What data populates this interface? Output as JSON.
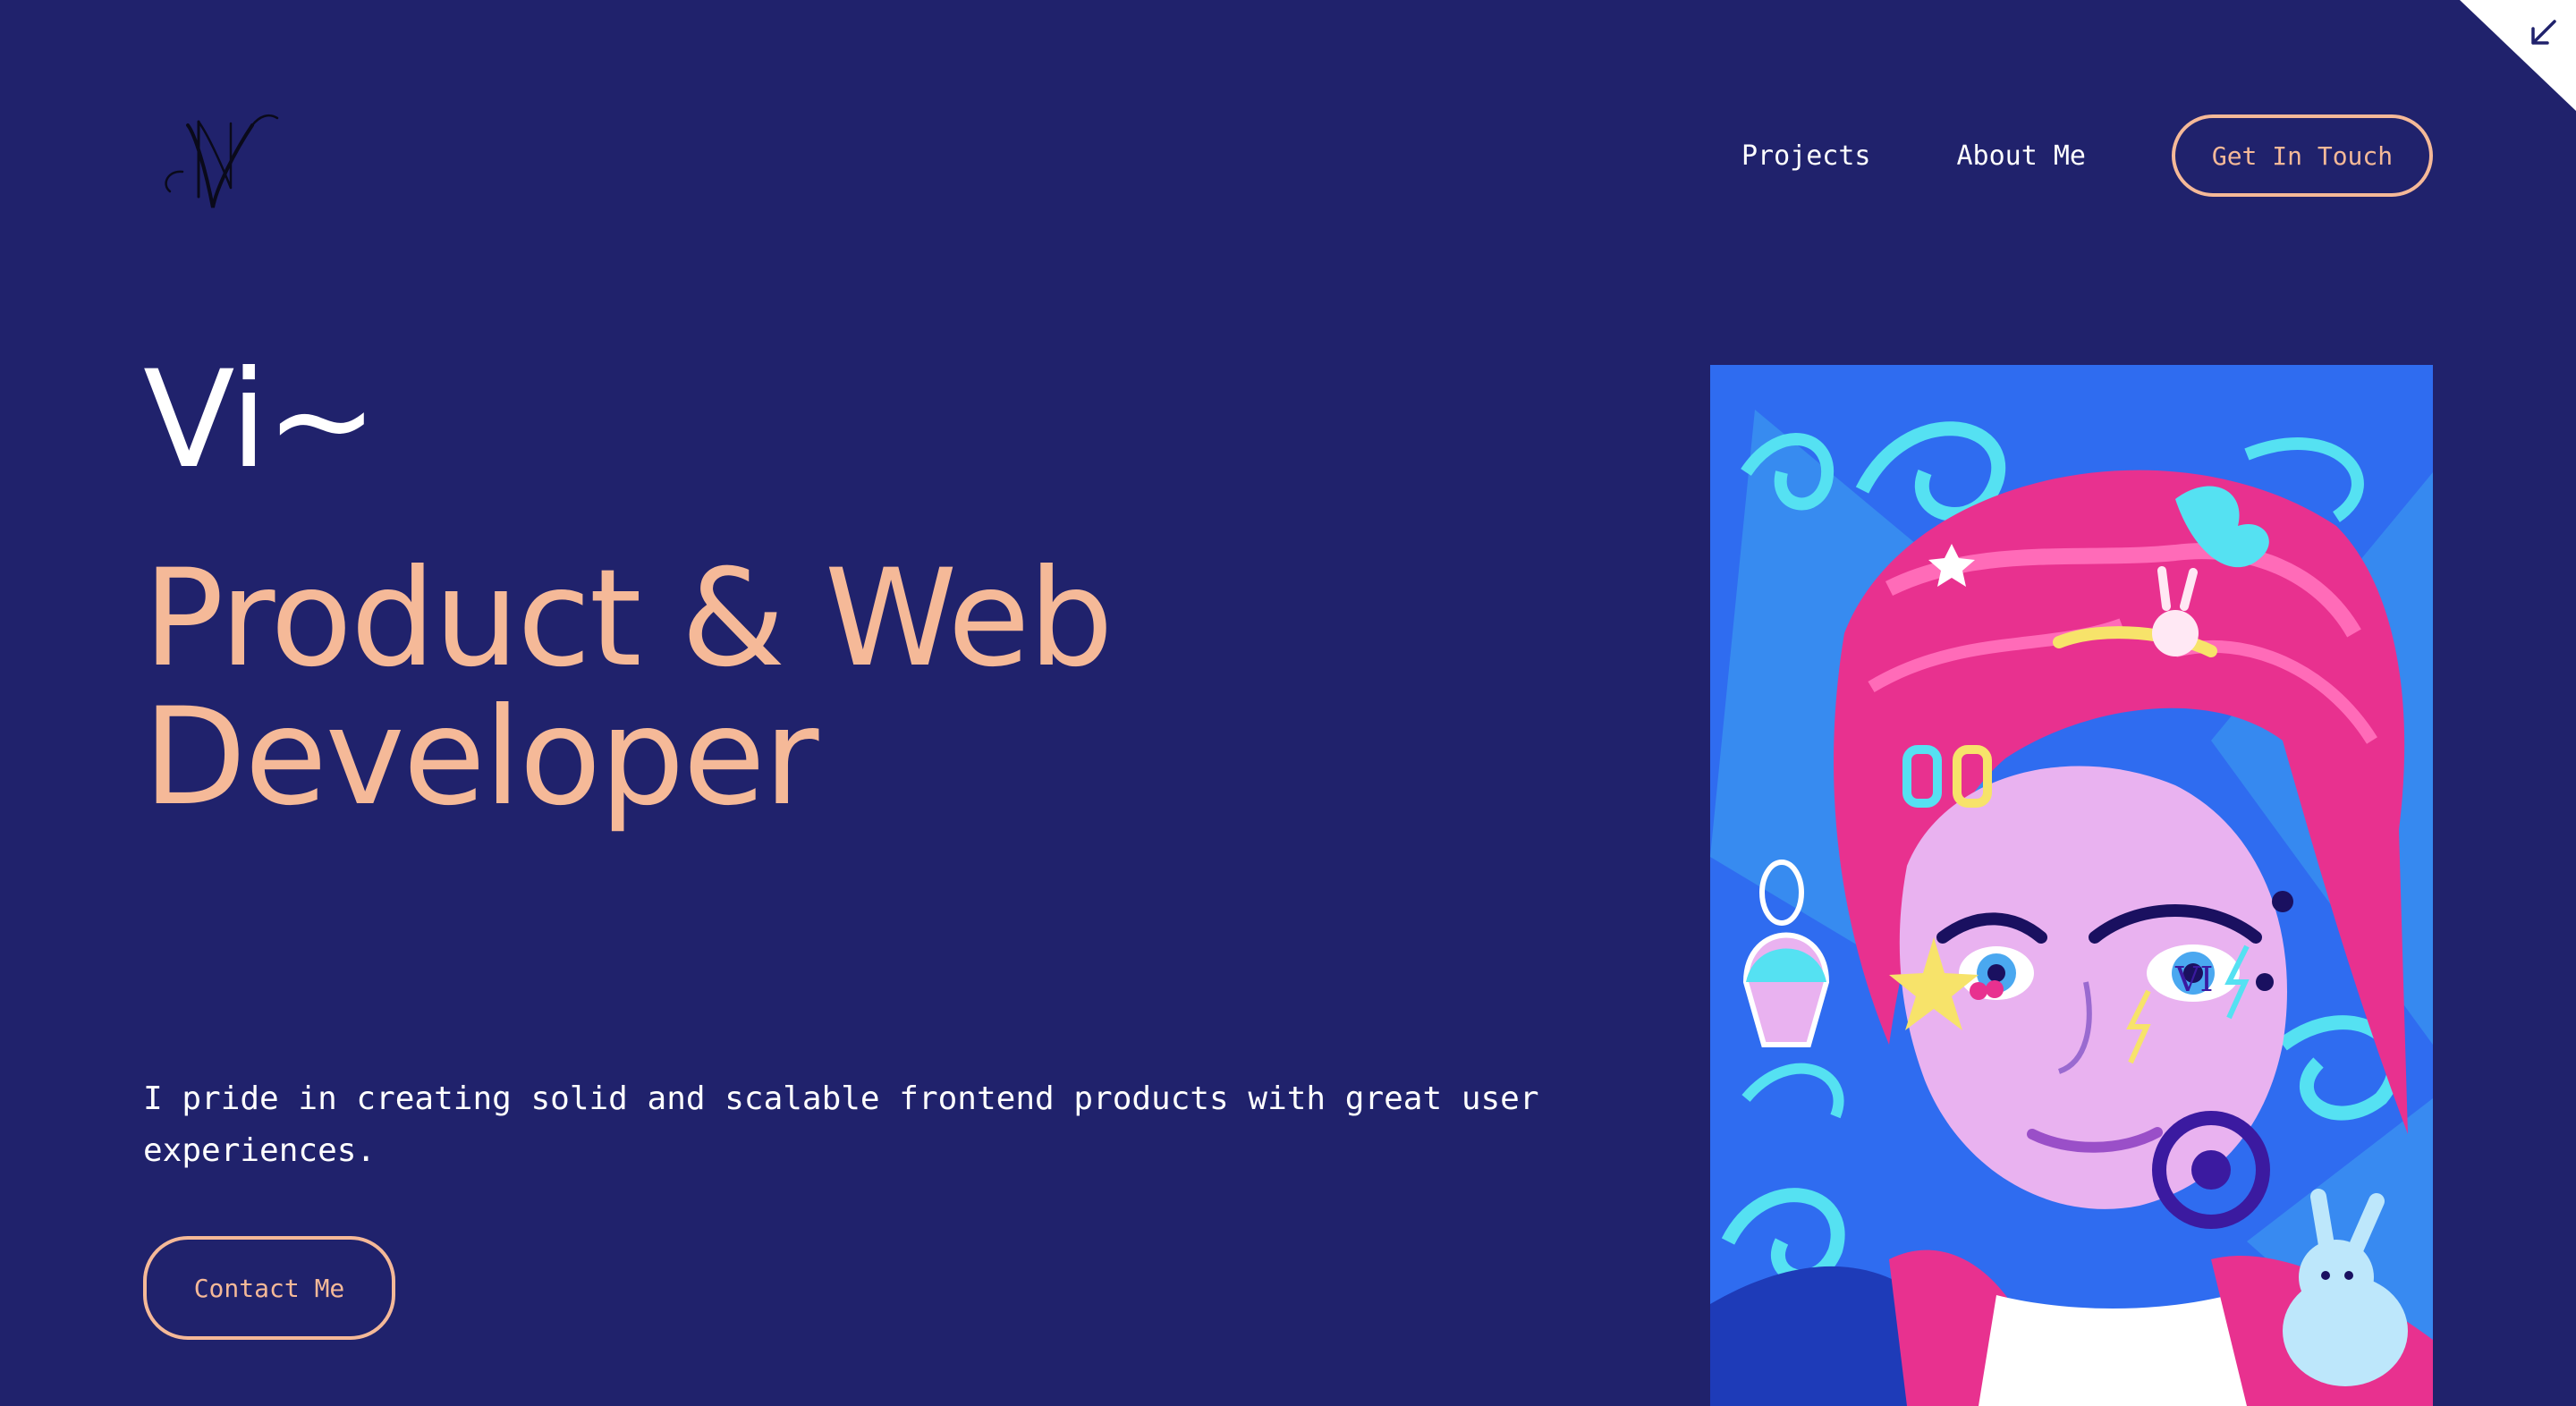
{
  "nav": {
    "projects": "Projects",
    "about": "About Me",
    "cta": "Get In Touch"
  },
  "hero": {
    "greeting": "Vi~",
    "headline_line1": "Product & Web",
    "headline_line2": "Developer",
    "intro": "I pride in creating solid and scalable frontend products with great user experiences.",
    "contact": "Contact Me"
  },
  "portrait": {
    "tattoo": "VI"
  },
  "colors": {
    "background": "#20226c",
    "accent": "#f5b998",
    "text": "#ffffff",
    "portrait_bg": "#2f6cf0"
  },
  "icons": {
    "logo": "nv-monogram-logo",
    "corner": "arrow-down-left-icon"
  }
}
